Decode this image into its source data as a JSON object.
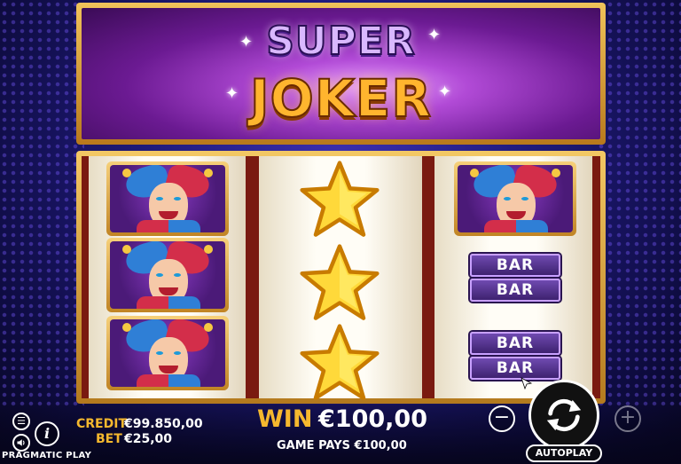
{
  "title": {
    "line1": "SUPER",
    "line2": "JOKER"
  },
  "reels": [
    {
      "symbols": [
        "joker-icon",
        "joker-icon",
        "joker-icon"
      ]
    },
    {
      "symbols": [
        "star-icon",
        "star-icon",
        "star-icon"
      ]
    },
    {
      "symbols": [
        "joker-icon",
        "BAR",
        "BAR",
        "BAR",
        "BAR"
      ]
    }
  ],
  "bar_symbol_text": "BAR",
  "credit": {
    "label": "CREDIT",
    "value": "€99.850,00"
  },
  "bet": {
    "label": "BET",
    "value": "€25,00"
  },
  "win": {
    "label": "WIN",
    "value": "€100,00"
  },
  "game_pays": "GAME PAYS €100,00",
  "controls": {
    "minus": "−",
    "plus": "+",
    "autoplay": "AUTOPLAY",
    "menu": "☰",
    "info": "i",
    "sound": "🔈"
  },
  "brand": "PRAGMATIC PLAY",
  "colors": {
    "accent_gold": "#f5b82e",
    "frame_gold": "#e0a53a",
    "banner_purple": "#7a2aa8",
    "bar_purple": "#5a3592",
    "background": "#1f1a7a"
  }
}
